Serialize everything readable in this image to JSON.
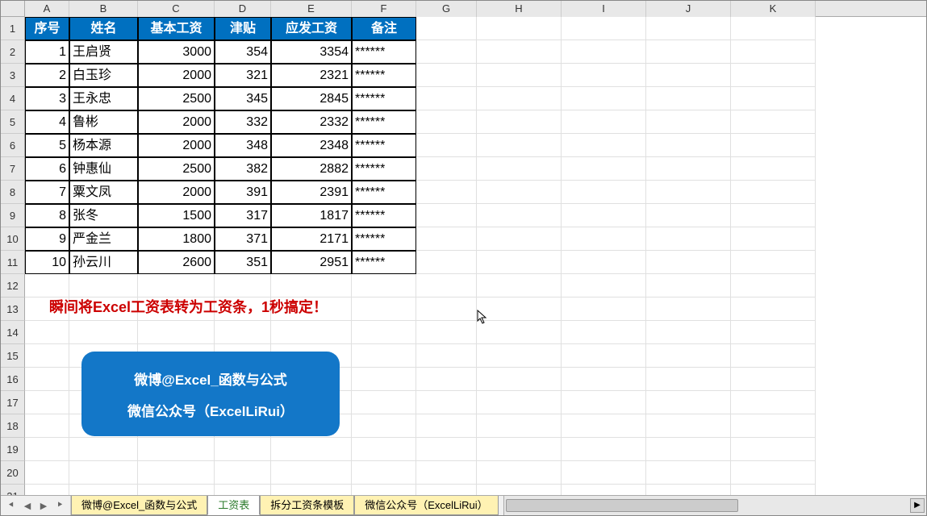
{
  "columns": [
    "A",
    "B",
    "C",
    "D",
    "E",
    "F",
    "G",
    "H",
    "I",
    "J",
    "K"
  ],
  "rowCount": 21,
  "tableHeaders": [
    "序号",
    "姓名",
    "基本工资",
    "津贴",
    "应发工资",
    "备注"
  ],
  "tableData": [
    {
      "id": "1",
      "name": "王启贤",
      "base": "3000",
      "allow": "354",
      "total": "3354",
      "note": "******"
    },
    {
      "id": "2",
      "name": "白玉珍",
      "base": "2000",
      "allow": "321",
      "total": "2321",
      "note": "******"
    },
    {
      "id": "3",
      "name": "王永忠",
      "base": "2500",
      "allow": "345",
      "total": "2845",
      "note": "******"
    },
    {
      "id": "4",
      "name": "鲁彬",
      "base": "2000",
      "allow": "332",
      "total": "2332",
      "note": "******"
    },
    {
      "id": "5",
      "name": "杨本源",
      "base": "2000",
      "allow": "348",
      "total": "2348",
      "note": "******"
    },
    {
      "id": "6",
      "name": "钟惠仙",
      "base": "2500",
      "allow": "382",
      "total": "2882",
      "note": "******"
    },
    {
      "id": "7",
      "name": "粟文凤",
      "base": "2000",
      "allow": "391",
      "total": "2391",
      "note": "******"
    },
    {
      "id": "8",
      "name": "张冬",
      "base": "1500",
      "allow": "317",
      "total": "1817",
      "note": "******"
    },
    {
      "id": "9",
      "name": "严金兰",
      "base": "1800",
      "allow": "371",
      "total": "2171",
      "note": "******"
    },
    {
      "id": "10",
      "name": "孙云川",
      "base": "2600",
      "allow": "351",
      "total": "2951",
      "note": "******"
    }
  ],
  "redNote": "瞬间将Excel工资表转为工资条，1秒搞定！",
  "blueBox": {
    "line1": "微博@Excel_函数与公式",
    "line2": "微信公众号（ExcelLiRui）"
  },
  "tabs": [
    {
      "label": "微博@Excel_函数与公式",
      "active": false
    },
    {
      "label": "工资表",
      "active": true
    },
    {
      "label": "拆分工资条模板",
      "active": false
    },
    {
      "label": "微信公众号（ExcelLiRui）",
      "active": false
    }
  ],
  "colWidths": {
    "A": 55,
    "B": 85,
    "C": 95,
    "D": 70,
    "E": 100,
    "F": 80,
    "G": 75,
    "H": 105,
    "I": 105,
    "J": 105,
    "K": 105
  }
}
